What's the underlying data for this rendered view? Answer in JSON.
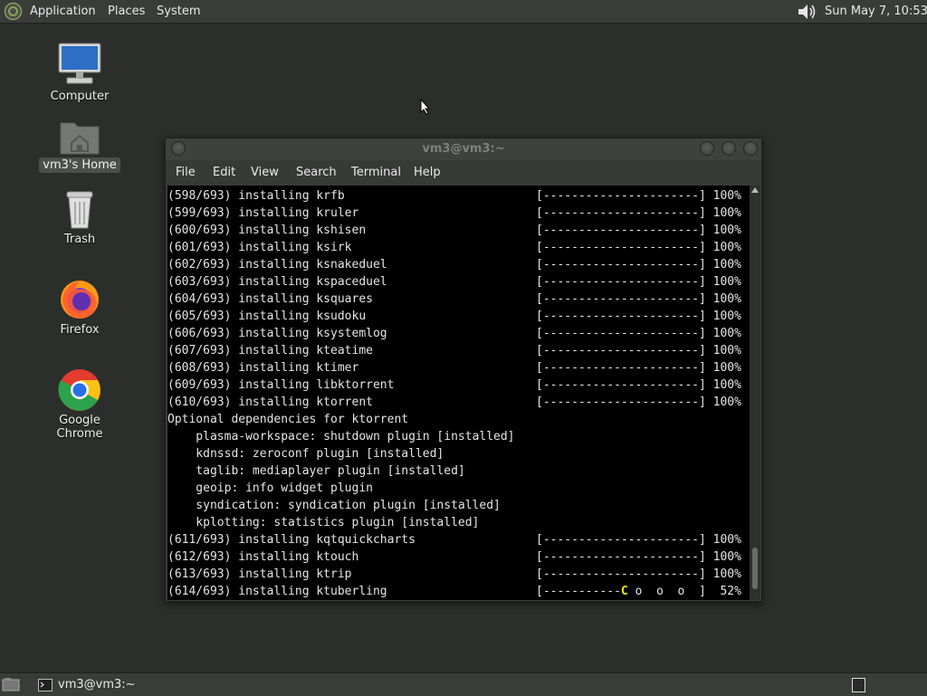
{
  "top_panel": {
    "applications": "Applications",
    "places": "Places",
    "system": "System",
    "clock": "Sun May  7, 10:53"
  },
  "desktop_icons": {
    "computer": "Computer",
    "home": "vm3's Home",
    "trash": "Trash",
    "firefox": "Firefox",
    "chrome": "Google Chrome"
  },
  "terminal": {
    "title": "vm3@vm3:~",
    "menu": [
      "File",
      "Edit",
      "View",
      "Search",
      "Terminal",
      "Help"
    ],
    "lines": [
      "(598/693) installing krfb                           [----------------------] 100%",
      "(599/693) installing kruler                         [----------------------] 100%",
      "(600/693) installing kshisen                        [----------------------] 100%",
      "(601/693) installing ksirk                          [----------------------] 100%",
      "(602/693) installing ksnakeduel                     [----------------------] 100%",
      "(603/693) installing kspaceduel                     [----------------------] 100%",
      "(604/693) installing ksquares                       [----------------------] 100%",
      "(605/693) installing ksudoku                        [----------------------] 100%",
      "(606/693) installing ksystemlog                     [----------------------] 100%",
      "(607/693) installing kteatime                       [----------------------] 100%",
      "(608/693) installing ktimer                         [----------------------] 100%",
      "(609/693) installing libktorrent                    [----------------------] 100%",
      "(610/693) installing ktorrent                       [----------------------] 100%",
      "Optional dependencies for ktorrent",
      "    plasma-workspace: shutdown plugin [installed]",
      "    kdnssd: zeroconf plugin [installed]",
      "    taglib: mediaplayer plugin [installed]",
      "    geoip: info widget plugin",
      "    syndication: syndication plugin [installed]",
      "    kplotting: statistics plugin [installed]",
      "(611/693) installing kqtquickcharts                 [----------------------] 100%",
      "(612/693) installing ktouch                         [----------------------] 100%",
      "(613/693) installing ktrip                          [----------------------] 100%"
    ],
    "last_line_prefix": "(614/693) installing ktuberling                     [-----------",
    "last_line_pacman": "C",
    "last_line_suffix": " o  o  o  ]  52%"
  },
  "taskbar": {
    "terminal_task": "vm3@vm3:~"
  },
  "colors": {
    "panel": "#3a3c3a",
    "desktop": "#2c2e2b",
    "terminal_bg": "#000000",
    "pacman": "#f0f000"
  }
}
